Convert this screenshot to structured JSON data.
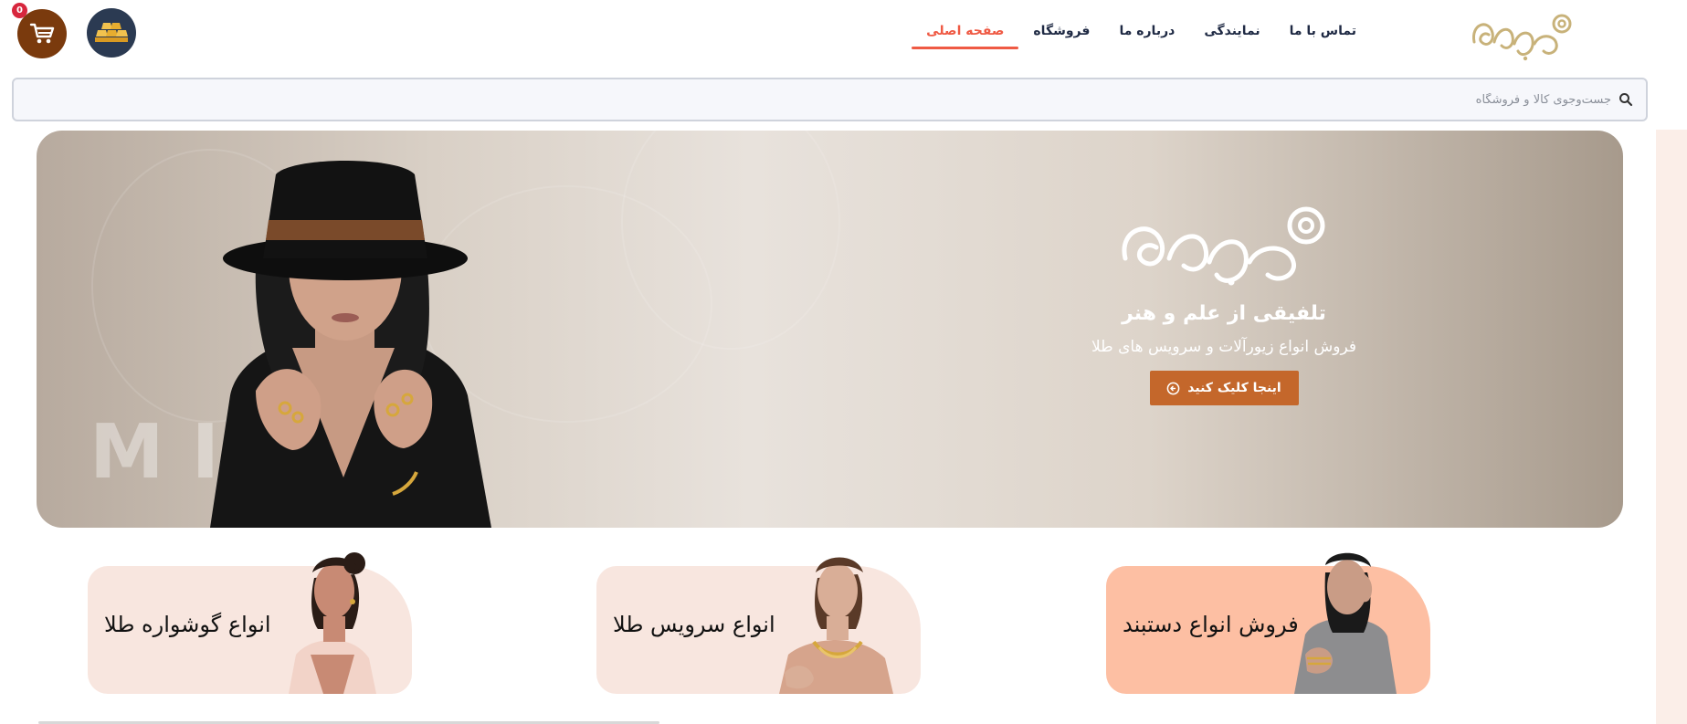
{
  "header": {
    "cart_count": "0",
    "nav": [
      {
        "label": "صفحه اصلی",
        "active": true
      },
      {
        "label": "فروشگاه",
        "active": false
      },
      {
        "label": "درباره ما",
        "active": false
      },
      {
        "label": "نمایندگی",
        "active": false
      },
      {
        "label": "تماس با ما",
        "active": false
      }
    ],
    "icons": {
      "cart": "cart-icon",
      "gold": "gold-bars-icon",
      "logo": "mijan-logo"
    }
  },
  "search": {
    "placeholder": "جست‌وجوی کالا و فروشگاه",
    "value": ""
  },
  "banner": {
    "watermark": "MIJAN",
    "title": "تلفیقی از علم و هنر",
    "subtitle": "فروش انواع زیورآلات و سرویس های طلا",
    "cta_label": "اینجا کلیک کنید"
  },
  "categories": [
    {
      "label": "فروش انواع دستبند",
      "bg": "#fdbfa3"
    },
    {
      "label": "انواع سرویس طلا",
      "bg": "#f8e6df"
    },
    {
      "label": "انواع گوشواره طلا",
      "bg": "#f8e6df"
    }
  ],
  "colors": {
    "accent": "#ef5a44",
    "cart_bg": "#7a3a0d",
    "gold_bg": "#2b3a52",
    "cta_bg": "#c4672b",
    "nav_text": "#1f2a44"
  }
}
